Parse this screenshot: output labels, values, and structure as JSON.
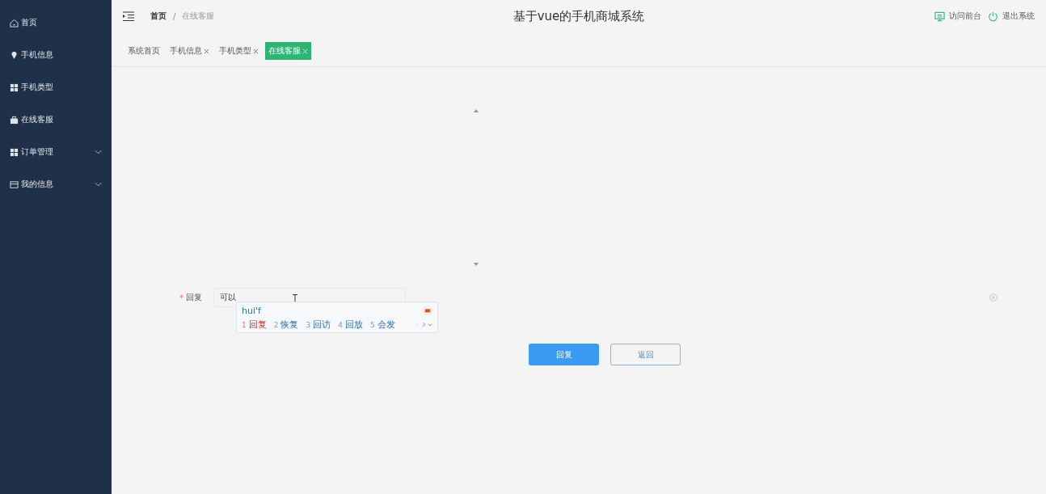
{
  "sidebar": {
    "items": [
      {
        "label": "首页",
        "expandable": false
      },
      {
        "label": "手机信息",
        "expandable": false
      },
      {
        "label": "手机类型",
        "expandable": false
      },
      {
        "label": "在线客服",
        "expandable": false
      },
      {
        "label": "订单管理",
        "expandable": true
      },
      {
        "label": "我的信息",
        "expandable": true
      }
    ]
  },
  "header": {
    "breadcrumb": [
      "首页",
      "在线客服"
    ],
    "breadcrumb_separator": "/",
    "title": "基于vue的手机商城系统",
    "actions": [
      "访问前台",
      "退出系统"
    ]
  },
  "tabs": [
    {
      "label": "系统首页",
      "closable": false,
      "selected": false
    },
    {
      "label": "手机信息",
      "closable": true,
      "selected": false
    },
    {
      "label": "手机类型",
      "closable": true,
      "selected": false
    },
    {
      "label": "在线客服",
      "closable": true,
      "selected": true
    }
  ],
  "form": {
    "label": "回复",
    "required_mark": "*",
    "value": "可以"
  },
  "ime": {
    "composition": "hui'f",
    "candidates": [
      {
        "number": "1",
        "text": "回复",
        "selected": true
      },
      {
        "number": "2",
        "text": "恢复",
        "selected": false
      },
      {
        "number": "3",
        "text": "回访",
        "selected": false
      },
      {
        "number": "4",
        "text": "回放",
        "selected": false
      },
      {
        "number": "5",
        "text": "会发",
        "selected": false
      }
    ]
  },
  "buttons": [
    {
      "label": "回复",
      "kind": "primary"
    },
    {
      "label": "返回",
      "kind": "plain"
    }
  ]
}
